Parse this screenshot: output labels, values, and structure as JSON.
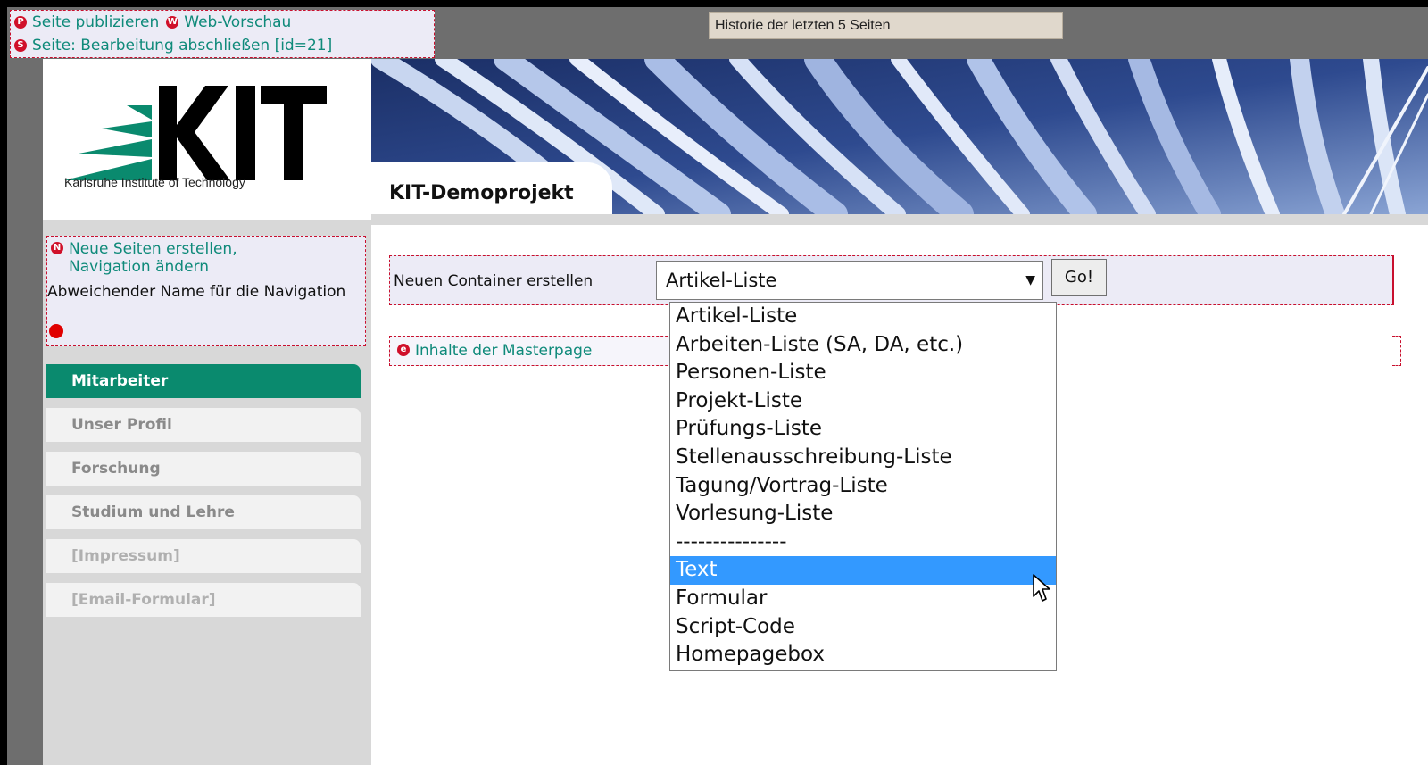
{
  "admin_toolbar": {
    "publish_label": "Seite publizieren",
    "publish_badge": "P",
    "preview_label": "Web-Vorschau",
    "preview_badge": "W",
    "finish_label": "Seite: Bearbeitung abschließen [id=21]",
    "finish_badge": "S"
  },
  "history": {
    "label": "Historie der letzten 5 Seiten"
  },
  "logo": {
    "text": "Karlsruhe Institute of Technology",
    "mark": "KIT"
  },
  "project": {
    "title": "KIT-Demoprojekt"
  },
  "sidebar": {
    "new_pages_badge": "N",
    "new_pages_link": "Neue Seiten erstellen, Navigation ändern",
    "nav_name_label": "Abweichender Name für die Navigation",
    "items": [
      {
        "label": "Mitarbeiter",
        "active": true
      },
      {
        "label": "Unser Profil"
      },
      {
        "label": "Forschung"
      },
      {
        "label": "Studium und Lehre"
      },
      {
        "label": "[Impressum]"
      },
      {
        "label": "[Email-Formular]"
      }
    ]
  },
  "main": {
    "container_label": "Neuen Container erstellen",
    "select_value": "Artikel-Liste",
    "go_label": "Go!",
    "master_badge": "e",
    "master_link": "Inhalte der Masterpage"
  },
  "dropdown": {
    "options": [
      "Artikel-Liste",
      "Arbeiten-Liste (SA, DA, etc.)",
      "Personen-Liste",
      "Projekt-Liste",
      "Prüfungs-Liste",
      "Stellenausschreibung-Liste",
      "Tagung/Vortrag-Liste",
      "Vorlesung-Liste",
      "---------------",
      "Text",
      "Formular",
      "Script-Code",
      "Homepagebox"
    ],
    "highlighted": "Text"
  },
  "colors": {
    "accent_green": "#0a8a6e",
    "link_teal": "#0f8a7a",
    "admin_red": "#c8102e",
    "highlight_blue": "#3399ff"
  }
}
